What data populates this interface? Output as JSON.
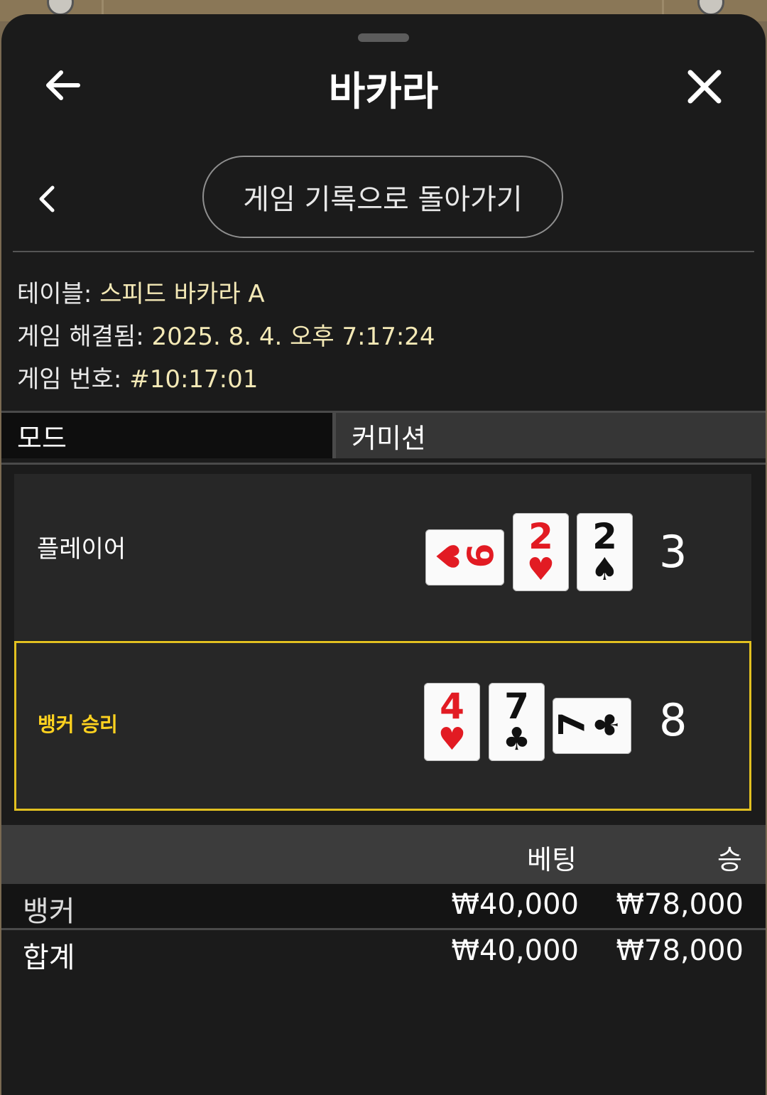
{
  "header": {
    "title": "바카라"
  },
  "nav": {
    "history_button": "게임 기록으로 돌아가기"
  },
  "info": {
    "table_label": "테이블:",
    "table_value": "스피드 바카라 A",
    "resolved_label": "게임 해결됨:",
    "resolved_value": "2025. 8. 4. 오후 7:17:24",
    "game_no_label": "게임 번호:",
    "game_no_value": "#10:17:01"
  },
  "tabs": {
    "mode": "모드",
    "commission": "커미션"
  },
  "player": {
    "label": "플레이어",
    "score": "3",
    "cards": [
      {
        "rank": "9",
        "suit": "♥",
        "color": "#e21b23",
        "orientation": "sideways"
      },
      {
        "rank": "2",
        "suit": "♥",
        "color": "#e21b23",
        "orientation": "upright"
      },
      {
        "rank": "2",
        "suit": "♠",
        "color": "#111111",
        "orientation": "upright"
      }
    ]
  },
  "banker": {
    "label": "뱅커 승리",
    "score": "8",
    "cards": [
      {
        "rank": "4",
        "suit": "♥",
        "color": "#e21b23",
        "orientation": "upright"
      },
      {
        "rank": "7",
        "suit": "♣",
        "color": "#111111",
        "orientation": "upright"
      },
      {
        "rank": "7",
        "suit": "♣",
        "color": "#111111",
        "orientation": "sideways"
      }
    ],
    "highlight_color": "#e2c020"
  },
  "bets": {
    "headers": {
      "bet": "베팅",
      "win": "승"
    },
    "rows": [
      {
        "label": "뱅커",
        "bet": "₩40,000",
        "win": "₩78,000"
      },
      {
        "label": "합계",
        "bet": "₩40,000",
        "win": "₩78,000"
      }
    ]
  },
  "icons": {
    "back": "arrow-left-icon",
    "close": "close-icon",
    "previous": "chevron-left-icon"
  }
}
